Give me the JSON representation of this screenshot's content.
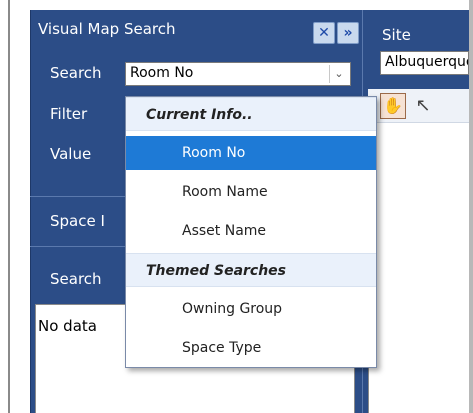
{
  "panel": {
    "title": "Visual Map Search",
    "buttons": {
      "close": "✕",
      "expand": "»"
    },
    "search_label": "Search",
    "search_value": "Room No",
    "filter_label": "Filter",
    "value_label": "Value",
    "section1_label": "Space I",
    "section2_label": "Search",
    "no_data": "No data"
  },
  "dropdown": {
    "groups": [
      {
        "label": "Current Info..",
        "items": [
          "Room No",
          "Room Name",
          "Asset Name"
        ]
      },
      {
        "label": "Themed Searches",
        "items": [
          "Owning Group",
          "Space Type"
        ]
      }
    ],
    "selected": "Room No"
  },
  "site": {
    "label": "Site",
    "value": "Albuquerque"
  },
  "colors": {
    "panel": "#2c4d87",
    "selected": "#1e7ad6",
    "group_bg": "#eaf1fb"
  }
}
